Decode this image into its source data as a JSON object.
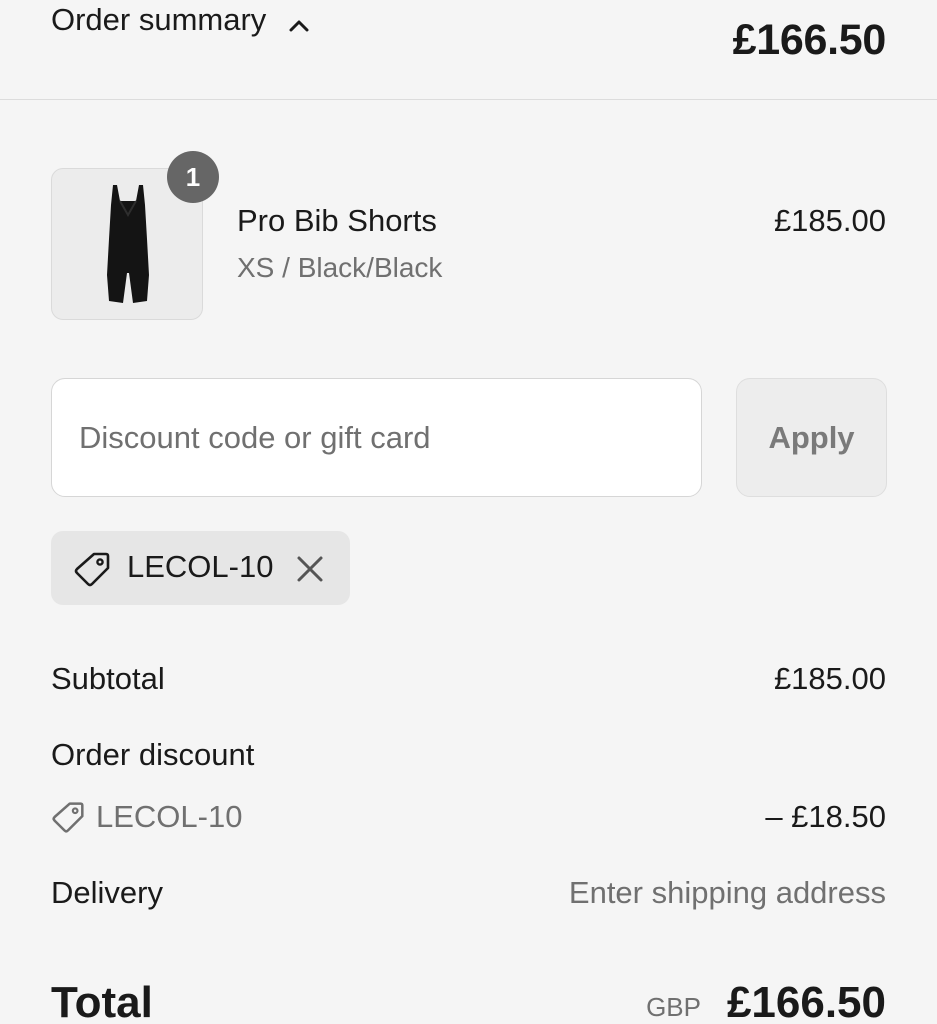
{
  "header": {
    "toggle_label": "Order summary",
    "total": "£166.50"
  },
  "product": {
    "quantity": "1",
    "name": "Pro Bib Shorts",
    "variant": "XS / Black/Black",
    "price": "£185.00",
    "image_icon": "bib-shorts-image"
  },
  "discount": {
    "placeholder": "Discount code or gift card",
    "value": "",
    "apply_label": "Apply",
    "applied_code": "LECOL-10"
  },
  "summary": {
    "subtotal_label": "Subtotal",
    "subtotal_value": "£185.00",
    "order_discount_label": "Order discount",
    "discount_code": "LECOL-10",
    "discount_value": "– £18.50",
    "delivery_label": "Delivery",
    "delivery_value": "Enter shipping address"
  },
  "total": {
    "label": "Total",
    "currency": "GBP",
    "value": "£166.50"
  },
  "colors": {
    "background": "#f5f5f5",
    "badge": "#666666",
    "muted_text": "#707070",
    "chip": "#e6e6e6"
  }
}
